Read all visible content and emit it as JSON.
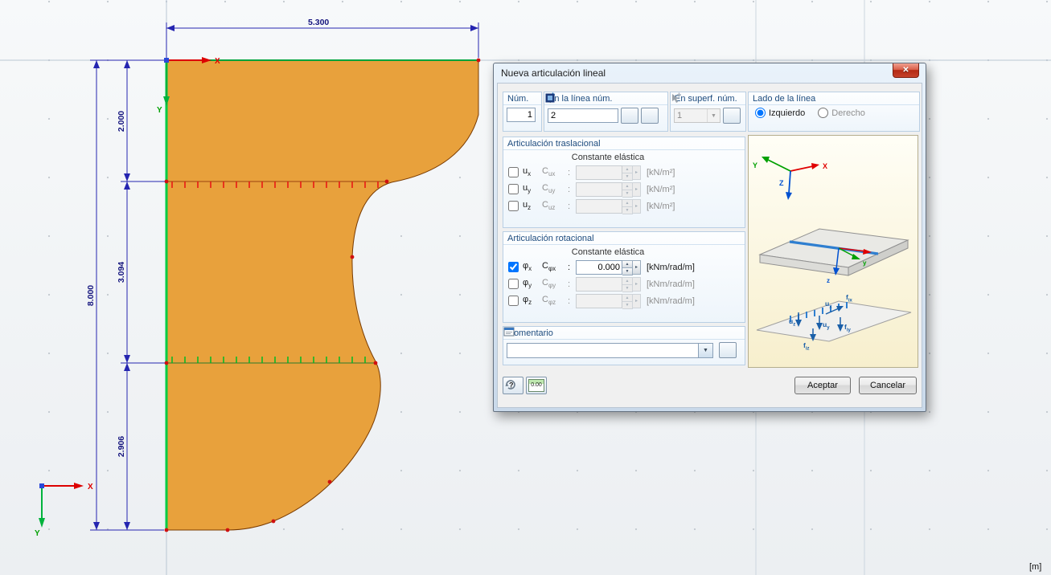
{
  "canvas": {
    "dim_top": "5.300",
    "dim_left_total": "8.000",
    "dim_seg_top": "2.000",
    "dim_seg_mid": "3.094",
    "dim_seg_bottom": "2.906",
    "axis_x": "X",
    "axis_y": "Y",
    "unit_label": "[m]"
  },
  "icons": {
    "close": "✕",
    "dropdown": "▼",
    "spin_up": "▲",
    "spin_down": "▼",
    "spin_more": "▸",
    "help": "?"
  },
  "dialog": {
    "title": "Nueva articulación lineal",
    "colon": ":",
    "num": {
      "label": "Núm.",
      "value": "1"
    },
    "line": {
      "label": "En la línea núm.",
      "value": "2"
    },
    "surface": {
      "label": "En superf. núm.",
      "value": "1"
    },
    "side": {
      "label": "Lado de la línea",
      "left": "Izquierdo",
      "right": "Derecho"
    },
    "trans": {
      "title": "Articulación traslacional",
      "header": "Constante elástica",
      "rows": [
        {
          "dof": "u",
          "dof_sub": "x",
          "c": "C",
          "c_sub": "ux",
          "value": "",
          "unit": "[kN/m²]",
          "checked": false
        },
        {
          "dof": "u",
          "dof_sub": "y",
          "c": "C",
          "c_sub": "uy",
          "value": "",
          "unit": "[kN/m²]",
          "checked": false
        },
        {
          "dof": "u",
          "dof_sub": "z",
          "c": "C",
          "c_sub": "uz",
          "value": "",
          "unit": "[kN/m²]",
          "checked": false
        }
      ]
    },
    "rot": {
      "title": "Articulación rotacional",
      "header": "Constante elástica",
      "rows": [
        {
          "dof": "φ",
          "dof_sub": "x",
          "c": "C",
          "c_sub": "φx",
          "value": "0.000",
          "unit": "[kNm/rad/m]",
          "checked": true
        },
        {
          "dof": "φ",
          "dof_sub": "y",
          "c": "C",
          "c_sub": "φy",
          "value": "",
          "unit": "[kNm/rad/m]",
          "checked": false
        },
        {
          "dof": "φ",
          "dof_sub": "z",
          "c": "C",
          "c_sub": "φz",
          "value": "",
          "unit": "[kNm/rad/m]",
          "checked": false
        }
      ]
    },
    "comment": {
      "label": "Comentario",
      "value": ""
    },
    "calc_button": "0.00",
    "ok": "Aceptar",
    "cancel": "Cancelar",
    "illus": {
      "axis_x": "X",
      "axis_y": "Y",
      "axis_z": "Z",
      "plate_y": "y",
      "plate_z": "z",
      "ux": "u",
      "ux_sub": "x",
      "uy": "u",
      "uy_sub": "y",
      "uz": "u",
      "uz_sub": "z",
      "fix": "f",
      "fix_sub": "ix",
      "fiy": "f",
      "fiy_sub": "iy",
      "fiz": "f",
      "fiz_sub": "iz"
    }
  }
}
